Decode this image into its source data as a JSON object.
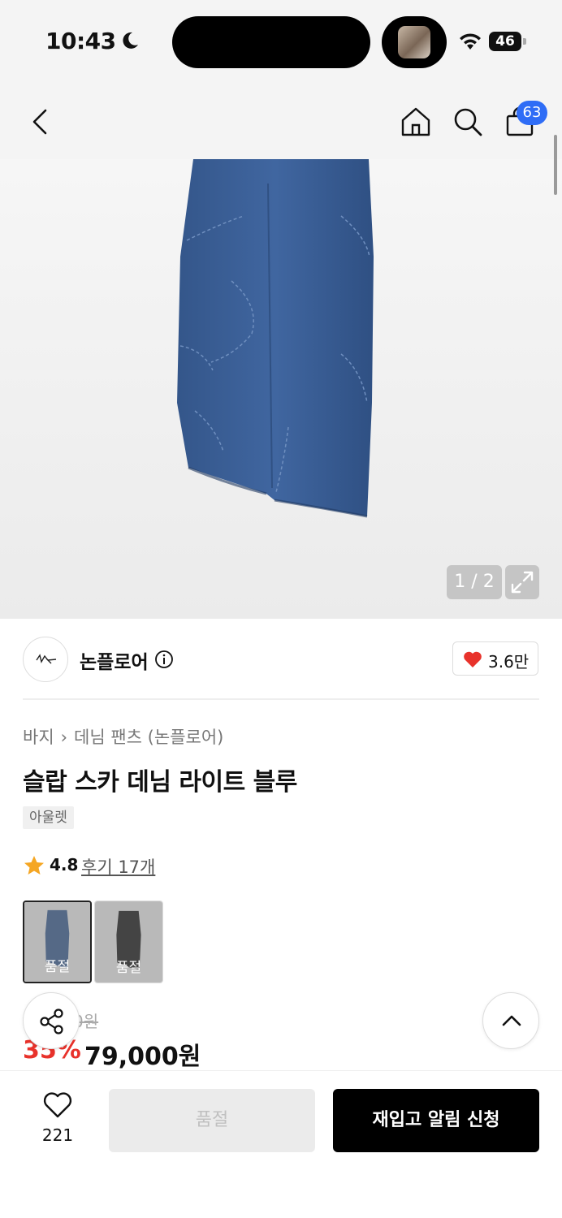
{
  "status_bar": {
    "time": "10:43",
    "battery": "46"
  },
  "nav": {
    "cart_count": "63"
  },
  "gallery": {
    "counter": "1 / 2"
  },
  "brand": {
    "name": "논플로어",
    "like_count": "3.6만"
  },
  "product": {
    "breadcrumb": [
      "바지",
      "데님 팬츠 (논플로어)"
    ],
    "title": "슬랍 스카 데님 라이트 블루",
    "tag": "아울렛",
    "rating": "4.8",
    "reviews": "후기 17개"
  },
  "colors": [
    {
      "label": "품절",
      "swatch": "#3a5d92"
    },
    {
      "label": "품절",
      "swatch": "#1a1a1a"
    }
  ],
  "price": {
    "original": "0원",
    "discount": "35%",
    "final": "79,000원"
  },
  "bottom_bar": {
    "wish_count": "221",
    "soldout_label": "품절",
    "restock_label": "재입고 알림 신청"
  },
  "colors_theme": {
    "accent": "#2f6df6",
    "discount": "#e8322b",
    "heart": "#e8322b",
    "denim": "#3b5f95",
    "star": "#f5a623"
  }
}
